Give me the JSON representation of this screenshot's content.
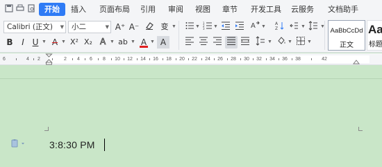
{
  "tabs": [
    {
      "label": "开始",
      "active": true
    },
    {
      "label": "插入"
    },
    {
      "label": "页面布局"
    },
    {
      "label": "引用"
    },
    {
      "label": "审阅"
    },
    {
      "label": "视图"
    },
    {
      "label": "章节"
    },
    {
      "label": "开发工具"
    },
    {
      "label": "云服务"
    },
    {
      "label": "文档助手"
    }
  ],
  "toolbar": {
    "font_name": "Calibri (正文)",
    "font_size": "小二",
    "grow_font": "A⁺",
    "shrink_font": "A⁻",
    "bold": "B",
    "italic": "I",
    "underline": "U",
    "strike": "A",
    "superscript": "X²",
    "subscript": "X₂",
    "font_color": "A",
    "char_shading": "A",
    "pinyin": "变",
    "highlight": "ab",
    "style_normal_sample": "AaBbCcDd",
    "style_normal_label": "正文",
    "style_heading_sample": "Aa",
    "style_heading_label": "标题"
  },
  "ruler": {
    "numbers": [
      "6",
      "4",
      "2",
      "2",
      "4",
      "6",
      "8",
      "10",
      "12",
      "14",
      "16",
      "18",
      "20",
      "22",
      "24",
      "26",
      "28",
      "30",
      "32",
      "34",
      "36",
      "38",
      "42"
    ]
  },
  "document": {
    "text": "3:8:30 PM"
  },
  "colors": {
    "accent": "#2f7bf5",
    "page_background": "#c9e6c8",
    "font_color_bar": "#e02020"
  }
}
